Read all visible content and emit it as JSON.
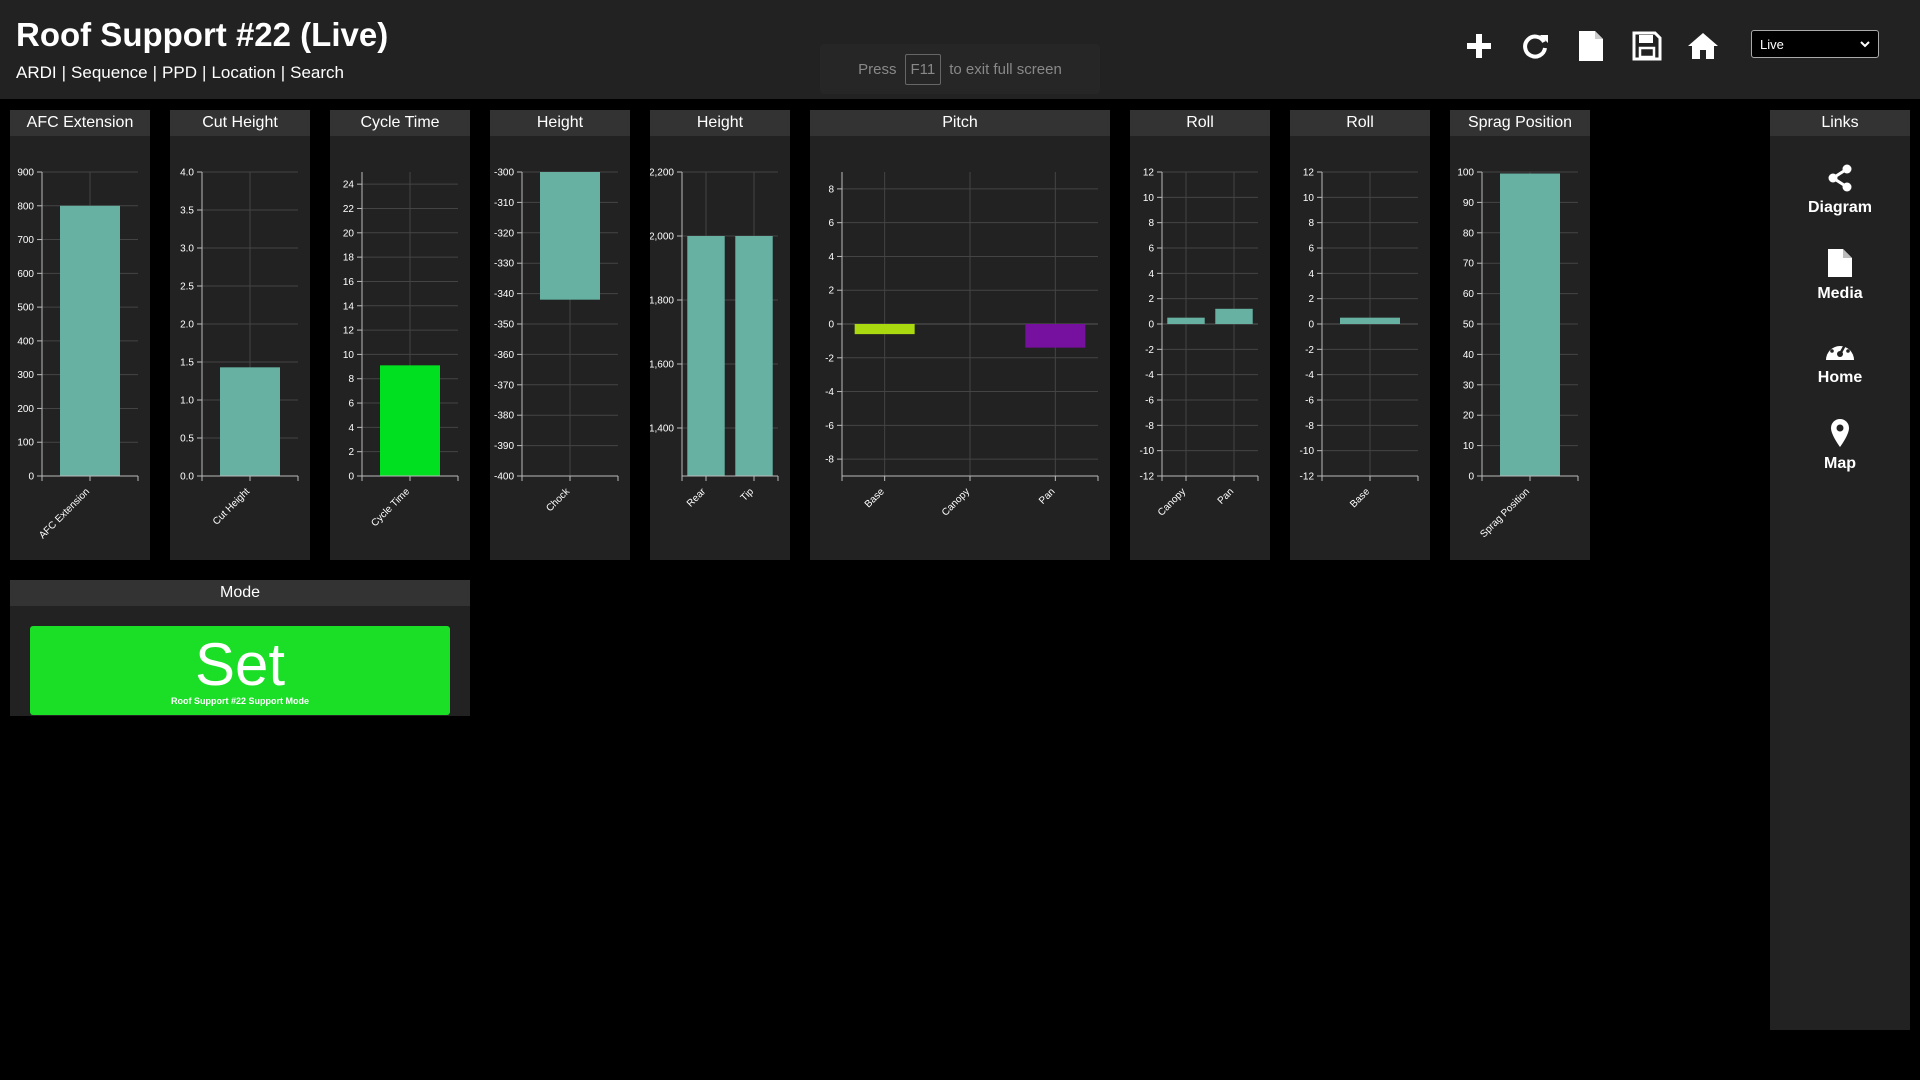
{
  "header": {
    "title": "Roof Support #22 (Live)",
    "nav": [
      "ARDI",
      "Sequence",
      "PPD",
      "Location",
      "Search"
    ],
    "fullscreen_hint": {
      "pre": "Press",
      "key": "F11",
      "post": "to exit full screen"
    },
    "toolbar_icons": [
      "plus-icon",
      "refresh-icon",
      "document-icon",
      "save-icon",
      "home-icon"
    ],
    "mode_select": {
      "value": "Live"
    }
  },
  "colors": {
    "bar": "#67b1a2",
    "green": "#00e020",
    "lime": "#a9d90e",
    "purple": "#75119e",
    "set": "#1adf26",
    "panel": "#222222",
    "panel_title": "#333333"
  },
  "chart_data": [
    {
      "type": "bar",
      "title": "AFC Extension",
      "categories": [
        "AFC Extension"
      ],
      "values": [
        800
      ],
      "ylim": [
        0,
        900
      ],
      "yticks": [
        0,
        100,
        200,
        300,
        400,
        500,
        600,
        700,
        800,
        900
      ],
      "tick_labels": [
        "0",
        "100",
        "200",
        "300",
        "400",
        "500",
        "600",
        "700",
        "800",
        "900"
      ],
      "colors": [
        "#67b1a2"
      ],
      "grid": true
    },
    {
      "type": "bar",
      "title": "Cut Height",
      "categories": [
        "Cut Height"
      ],
      "values": [
        1.43
      ],
      "ylim": [
        0,
        4.0
      ],
      "yticks": [
        0,
        0.5,
        1,
        1.5,
        2,
        2.5,
        3,
        3.5,
        4
      ],
      "tick_labels": [
        "0.0",
        "0.5",
        "1.0",
        "1.5",
        "2.0",
        "2.5",
        "3.0",
        "3.5",
        "4.0"
      ],
      "colors": [
        "#67b1a2"
      ],
      "grid": true
    },
    {
      "type": "bar",
      "title": "Cycle Time",
      "categories": [
        "Cycle Time"
      ],
      "values": [
        9.1
      ],
      "ylim": [
        0,
        25
      ],
      "yticks": [
        0,
        2,
        4,
        6,
        8,
        10,
        12,
        14,
        16,
        18,
        20,
        22,
        24
      ],
      "tick_labels": [
        "0",
        "2",
        "4",
        "6",
        "8",
        "10",
        "12",
        "14",
        "16",
        "18",
        "20",
        "22",
        "24"
      ],
      "colors": [
        "#00e020"
      ],
      "grid": true
    },
    {
      "type": "bar",
      "title": "Height",
      "categories": [
        "Chock"
      ],
      "values": [
        -342
      ],
      "ylim": [
        -400,
        -300
      ],
      "yticks": [
        -400,
        -390,
        -380,
        -370,
        -360,
        -350,
        -340,
        -330,
        -320,
        -310,
        -300
      ],
      "tick_labels": [
        "-400",
        "-390",
        "-380",
        "-370",
        "-360",
        "-350",
        "-340",
        "-330",
        "-320",
        "-310",
        "-300"
      ],
      "colors": [
        "#67b1a2"
      ],
      "grid": true
    },
    {
      "type": "bar",
      "title": "Height",
      "categories": [
        "Rear",
        "Tip"
      ],
      "values": [
        2000,
        2000
      ],
      "ylim": [
        1250,
        2200
      ],
      "yticks": [
        1400,
        1600,
        1800,
        2000,
        2200
      ],
      "tick_labels": [
        "1,400",
        "1,600",
        "1,800",
        "2,000",
        "2,200"
      ],
      "colors": [
        "#67b1a2",
        "#67b1a2"
      ],
      "grid": true
    },
    {
      "type": "bar",
      "title": "Pitch",
      "categories": [
        "Base",
        "Canopy",
        "Pan"
      ],
      "values": [
        -0.6,
        0,
        -1.4
      ],
      "ylim": [
        -9,
        9
      ],
      "yticks": [
        -8,
        -6,
        -4,
        -2,
        0,
        2,
        4,
        6,
        8
      ],
      "tick_labels": [
        "-8",
        "-6",
        "-4",
        "-2",
        "0",
        "2",
        "4",
        "6",
        "8"
      ],
      "colors": [
        "#a9d90e",
        "#67b1a2",
        "#75119e"
      ],
      "grid": true
    },
    {
      "type": "bar",
      "title": "Roll",
      "categories": [
        "Canopy",
        "Pan"
      ],
      "values": [
        0.5,
        1.2
      ],
      "ylim": [
        -12,
        12
      ],
      "yticks": [
        -12,
        -10,
        -8,
        -6,
        -4,
        -2,
        0,
        2,
        4,
        6,
        8,
        10,
        12
      ],
      "tick_labels": [
        "-12",
        "-10",
        "-8",
        "-6",
        "-4",
        "-2",
        "0",
        "2",
        "4",
        "6",
        "8",
        "10",
        "12"
      ],
      "colors": [
        "#67b1a2",
        "#67b1a2"
      ],
      "grid": true
    },
    {
      "type": "bar",
      "title": "Roll",
      "categories": [
        "Base"
      ],
      "values": [
        0.5
      ],
      "ylim": [
        -12,
        12
      ],
      "yticks": [
        -12,
        -10,
        -8,
        -6,
        -4,
        -2,
        0,
        2,
        4,
        6,
        8,
        10,
        12
      ],
      "tick_labels": [
        "-12",
        "-10",
        "-8",
        "-6",
        "-4",
        "-2",
        "0",
        "2",
        "4",
        "6",
        "8",
        "10",
        "12"
      ],
      "colors": [
        "#67b1a2"
      ],
      "grid": true
    },
    {
      "type": "bar",
      "title": "Sprag Position",
      "categories": [
        "Sprag Position"
      ],
      "values": [
        99.5
      ],
      "ylim": [
        0,
        100
      ],
      "yticks": [
        0,
        10,
        20,
        30,
        40,
        50,
        60,
        70,
        80,
        90,
        100
      ],
      "tick_labels": [
        "0",
        "10",
        "20",
        "30",
        "40",
        "50",
        "60",
        "70",
        "80",
        "90",
        "100"
      ],
      "colors": [
        "#67b1a2"
      ],
      "grid": true
    }
  ],
  "mode": {
    "title": "Mode",
    "button_label": "Set",
    "button_sub": "Roof Support #22 Support Mode"
  },
  "links": {
    "title": "Links",
    "items": [
      {
        "label": "Diagram",
        "icon": "share-icon"
      },
      {
        "label": "Media",
        "icon": "file-icon"
      },
      {
        "label": "Home",
        "icon": "dashboard-icon"
      },
      {
        "label": "Map",
        "icon": "map-pin-icon"
      }
    ]
  }
}
